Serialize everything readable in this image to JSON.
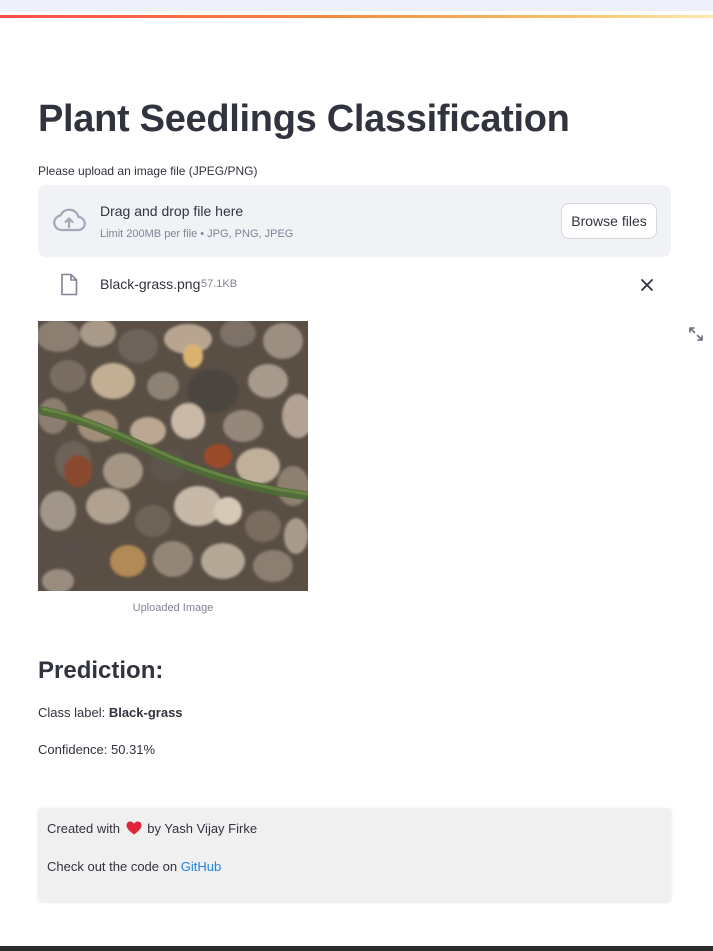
{
  "app": {
    "title": "Plant Seedlings Classification",
    "upload_label": "Please upload an image file (JPEG/PNG)"
  },
  "uploader": {
    "drop_title": "Drag and drop file here",
    "limit_text": "Limit 200MB per file • JPG, PNG, JPEG",
    "browse_label": "Browse files",
    "icon": "cloud-upload-icon"
  },
  "file": {
    "name": "Black-grass.png",
    "size": "57.1KB",
    "icon": "file-icon",
    "remove_icon": "close-icon"
  },
  "image": {
    "caption": "Uploaded Image",
    "expand_icon": "fullscreen-icon"
  },
  "prediction": {
    "heading": "Prediction:",
    "class_prefix": "Class label:",
    "class_value": "Black-grass",
    "confidence_text": "Confidence: 50.31%"
  },
  "footer": {
    "created_prefix": "Created with",
    "created_suffix": "by Yash Vijay Firke",
    "code_prefix": "Check out the code on",
    "github_label": "GitHub"
  },
  "colors": {
    "text": "#31333f",
    "muted": "#808495",
    "link": "#1c83e1",
    "heart": "#e0243b",
    "dropzone_bg": "#f0f2f6"
  }
}
